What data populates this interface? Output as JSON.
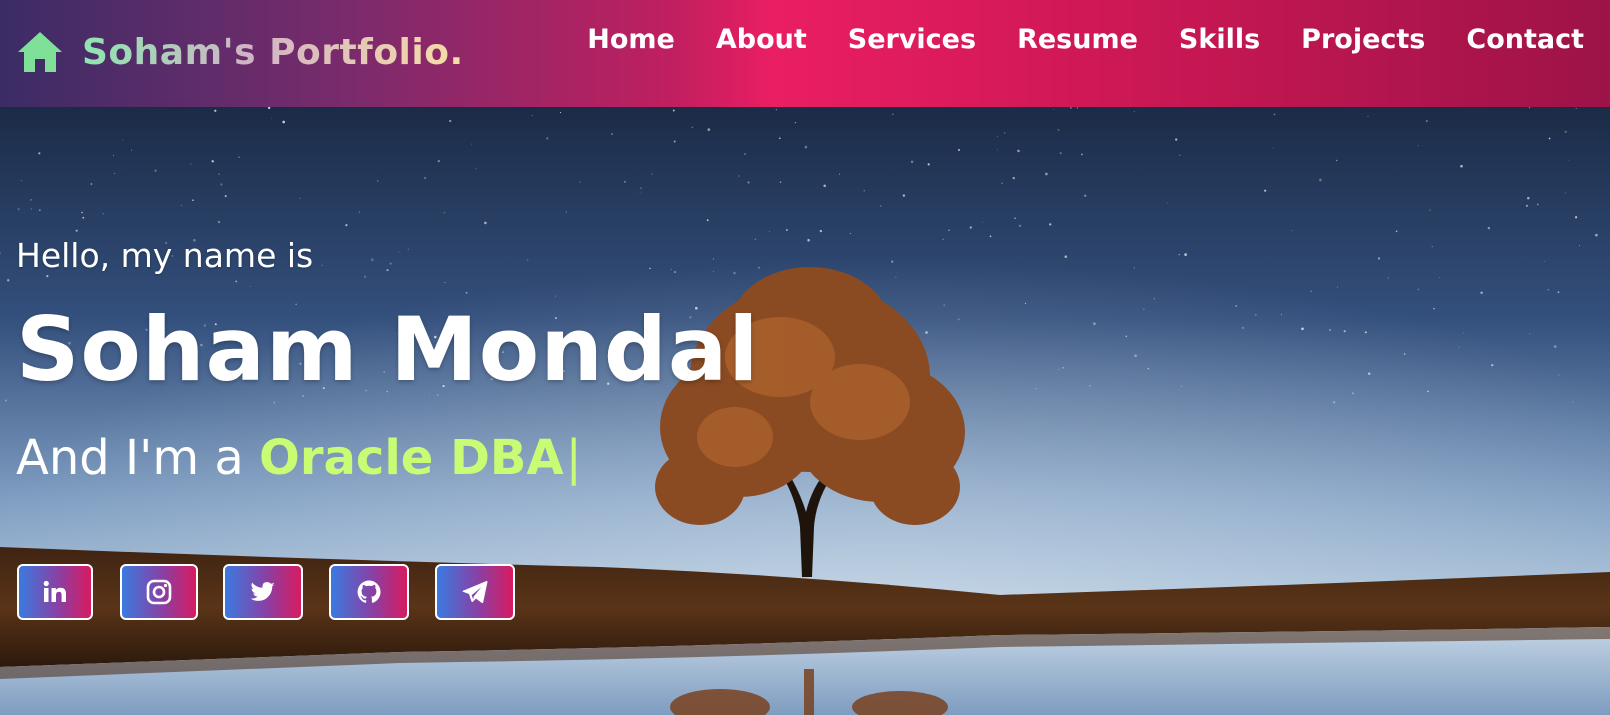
{
  "header": {
    "brand_title": "Soham's Portfolio.",
    "brand_icon": "home-icon",
    "nav": [
      {
        "label": "Home"
      },
      {
        "label": "About"
      },
      {
        "label": "Services"
      },
      {
        "label": "Resume"
      },
      {
        "label": "Skills"
      },
      {
        "label": "Projects"
      },
      {
        "label": "Contact"
      }
    ]
  },
  "hero": {
    "greeting": "Hello, my name is",
    "name": "Soham Mondal",
    "role_prefix": "And I'm a ",
    "role": "Oracle DBA",
    "cursor": "|",
    "background": "night-sky-tree-lake-image"
  },
  "socials": [
    {
      "icon": "linkedin-icon"
    },
    {
      "icon": "instagram-icon"
    },
    {
      "icon": "twitter-icon"
    },
    {
      "icon": "github-icon"
    },
    {
      "icon": "telegram-icon"
    }
  ],
  "colors": {
    "accent_role": "#c9fb74",
    "header_pink": "#ea1e63",
    "header_purple": "#3b2c66"
  }
}
